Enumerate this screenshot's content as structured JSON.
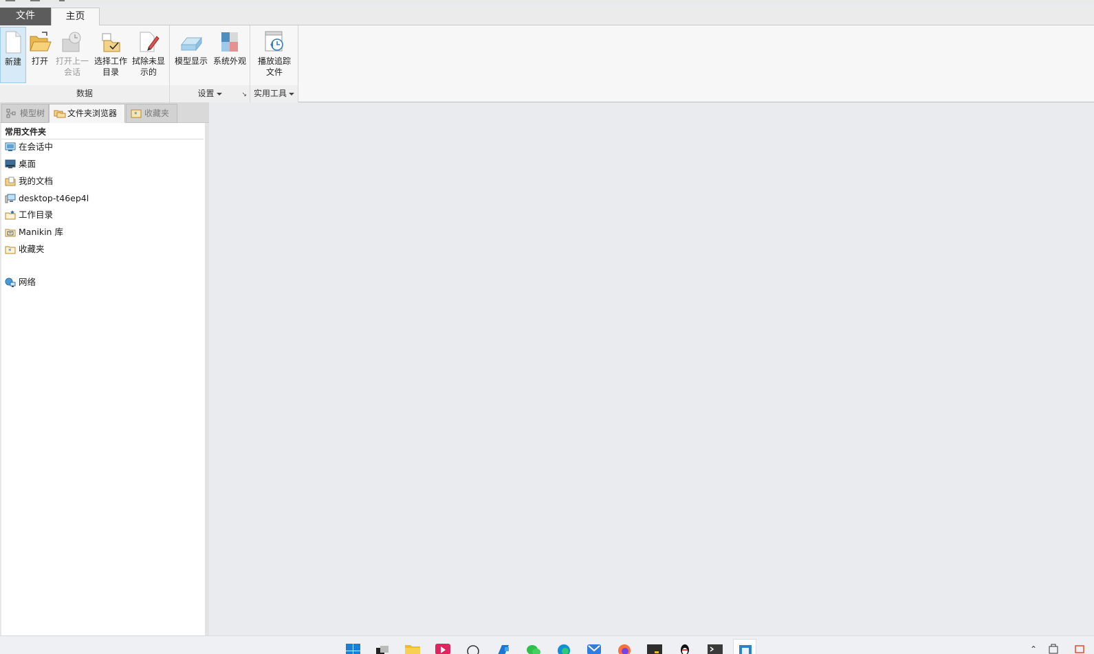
{
  "ribbon": {
    "tabs": [
      {
        "label": "文件"
      },
      {
        "label": "主页"
      }
    ],
    "groups": {
      "data": {
        "label": "数据",
        "buttons": [
          {
            "label": "新建",
            "icon": "new-file-icon"
          },
          {
            "label": "打开",
            "icon": "open-folder-icon"
          },
          {
            "label_line1": "打开上一",
            "label_line2": "会话",
            "icon": "open-last-session-icon",
            "disabled": true
          },
          {
            "label_line1": "选择工作",
            "label_line2": "目录",
            "icon": "select-working-directory-icon"
          },
          {
            "label_line1": "拭除未显",
            "label_line2": "示的",
            "icon": "erase-not-displayed-icon"
          }
        ]
      },
      "settings": {
        "label": "设置",
        "buttons": [
          {
            "label": "模型显示",
            "icon": "model-display-icon"
          },
          {
            "label": "系统外观",
            "icon": "system-appearance-icon"
          }
        ]
      },
      "utilities": {
        "label": "实用工具",
        "buttons": [
          {
            "label_line1": "播放追踪",
            "label_line2": "文件",
            "icon": "play-trail-file-icon"
          }
        ]
      }
    }
  },
  "panel": {
    "tabs": [
      {
        "label": "模型树",
        "icon": "model-tree-icon"
      },
      {
        "label": "文件夹浏览器",
        "icon": "folder-browser-icon"
      },
      {
        "label": "收藏夹",
        "icon": "favorites-icon"
      }
    ],
    "section_title": "常用文件夹",
    "items": [
      {
        "label": "在会话中",
        "icon": "in-session-icon"
      },
      {
        "label": "桌面",
        "icon": "desktop-icon"
      },
      {
        "label": "我的文档",
        "icon": "my-documents-icon"
      },
      {
        "label": "desktop-t46ep4l",
        "icon": "computer-icon"
      },
      {
        "label": "工作目录",
        "icon": "working-directory-icon"
      },
      {
        "label": "Manikin 库",
        "icon": "manikin-library-icon"
      },
      {
        "label": "收藏夹",
        "icon": "favorites-folder-icon"
      },
      {
        "label": "网络",
        "icon": "network-icon"
      }
    ]
  },
  "taskbar": {
    "icons": [
      "start-icon",
      "task-view-icon",
      "file-explorer-icon",
      "media-app-icon",
      "search-icon",
      "app-icon",
      "wechat-icon",
      "edge-icon",
      "mail-icon",
      "firefox-icon",
      "terminal-icon",
      "qq-icon",
      "console-icon",
      "creo-icon"
    ],
    "tray": [
      "chevron-up-icon",
      "input-icon",
      "notification-icon"
    ]
  }
}
